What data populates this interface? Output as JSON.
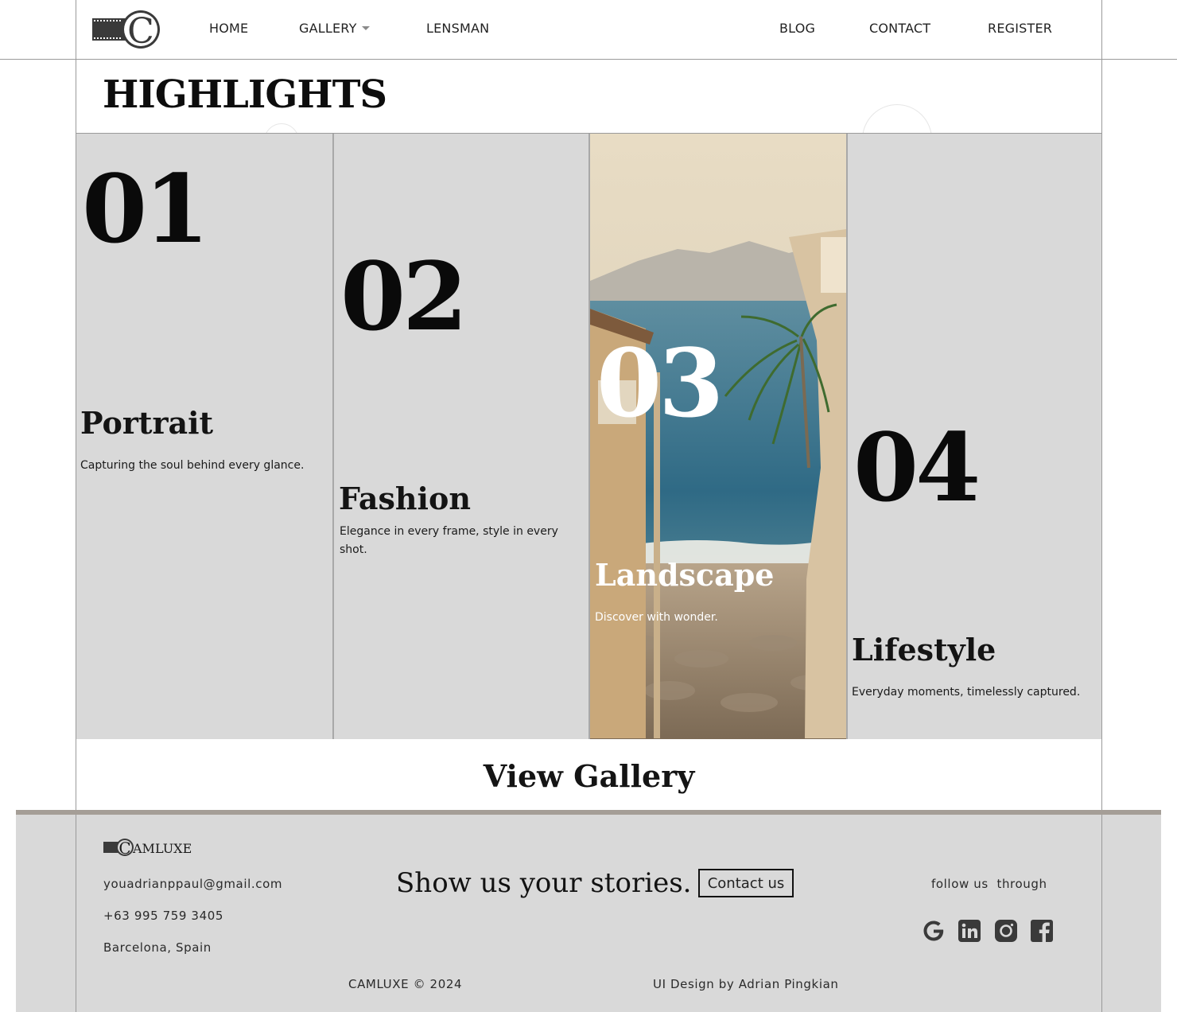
{
  "nav": {
    "home": "HOME",
    "gallery": "GALLERY",
    "lensman": "LENSMAN",
    "blog": "BLOG",
    "contact": "CONTACT",
    "register": "REGISTER"
  },
  "page_title": "HIGHLIGHTS",
  "cards": [
    {
      "number": "01",
      "category": "Portrait",
      "description": "Capturing the soul behind every glance."
    },
    {
      "number": "02",
      "category": "Fashion",
      "description": "Elegance in every frame, style in every shot."
    },
    {
      "number": "03",
      "category": "Landscape",
      "description": "Discover with wonder."
    },
    {
      "number": "04",
      "category": "Lifestyle",
      "description": "Everyday moments, timelessly captured."
    }
  ],
  "view_gallery": "View Gallery",
  "footer": {
    "brand": "AMLUXE",
    "email": "youadrianppaul@gmail.com",
    "phone": "+63 995 759 3405",
    "location": "Barcelona, Spain",
    "slogan": "Show us your stories.",
    "contact_button": "Contact us",
    "follow": "follow us  through",
    "copyright": "CAMLUXE © 2024",
    "credit": "UI Design by Adrian Pingkian",
    "social_icons": [
      "google-icon",
      "linkedin-icon",
      "instagram-icon",
      "facebook-icon"
    ]
  },
  "colors": {
    "panel": "#d9d9d9",
    "footer_bar": "#a59e97",
    "text": "#111111"
  }
}
